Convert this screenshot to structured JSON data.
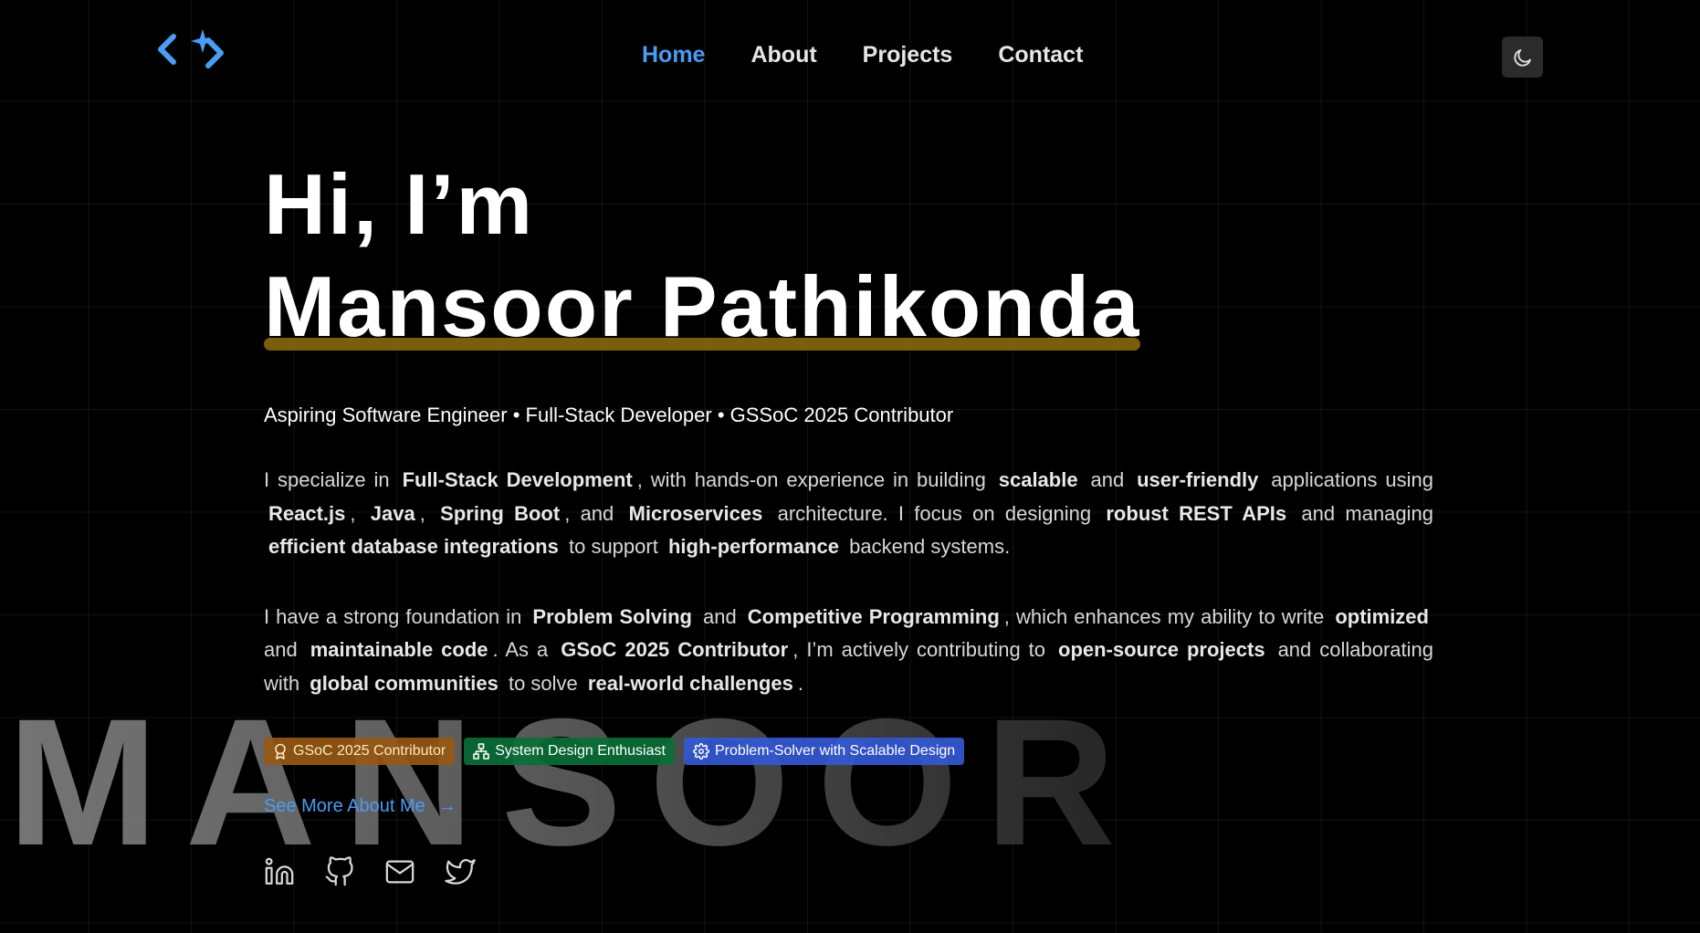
{
  "nav": {
    "items": [
      {
        "label": "Home",
        "active": true
      },
      {
        "label": "About",
        "active": false
      },
      {
        "label": "Projects",
        "active": false
      },
      {
        "label": "Contact",
        "active": false
      }
    ],
    "theme_toggle_icon": "moon-icon",
    "logo_icon": "code-sparkle-icon"
  },
  "hero": {
    "greeting": "Hi, I’m",
    "name": "Mansoor Pathikonda",
    "tagline": "Aspiring Software Engineer • Full-Stack Developer • GSSoC 2025 Contributor",
    "paragraph1": {
      "t1": "I specialize in",
      "b1": "Full-Stack Development",
      "t2": ", with hands-on experience in building",
      "b2": "scalable",
      "t3": "and",
      "b3": "user-friendly",
      "t4": "applications using",
      "b4": "React.js",
      "t5": ",",
      "b5": "Java",
      "t6": ",",
      "b6": "Spring Boot",
      "t7": ", and",
      "b7": "Microservices",
      "t8": "architecture. I focus on designing",
      "b8": "robust REST APIs",
      "t9": "and managing",
      "b9": "efficient database integrations",
      "t10": "to support",
      "b10": "high-performance",
      "t11": "backend systems."
    },
    "paragraph2": {
      "t1": "I have a strong foundation in",
      "b1": "Problem Solving",
      "t2": "and",
      "b2": "Competitive Programming",
      "t3": ", which enhances my ability to write",
      "b3": "optimized",
      "t4": "and",
      "b4": "maintainable code",
      "t5": ". As a",
      "b5": "GSoC 2025 Contributor",
      "t6": ", I’m actively contributing to",
      "b6": "open-source projects",
      "t7": "and collaborating with",
      "b7": "global communities",
      "t8": "to solve",
      "b8": "real-world challenges",
      "t9": "."
    },
    "badges": [
      {
        "label": "GSoC 2025 Contributor",
        "icon": "award-icon",
        "color": "#965814"
      },
      {
        "label": "System Design Enthusiast",
        "icon": "network-icon",
        "color": "#0a6e37"
      },
      {
        "label": "Problem-Solver with Scalable Design",
        "icon": "gear-icon",
        "color": "#3458d2"
      }
    ],
    "see_more": {
      "label": "See More About Me",
      "arrow": "→"
    },
    "socials": [
      "linkedin-icon",
      "github-icon",
      "mail-icon",
      "twitter-icon"
    ]
  },
  "watermark": "MANSOOR",
  "colors": {
    "accent": "#4a9cf5",
    "underline": "#7a5e0c",
    "background": "#000000"
  }
}
